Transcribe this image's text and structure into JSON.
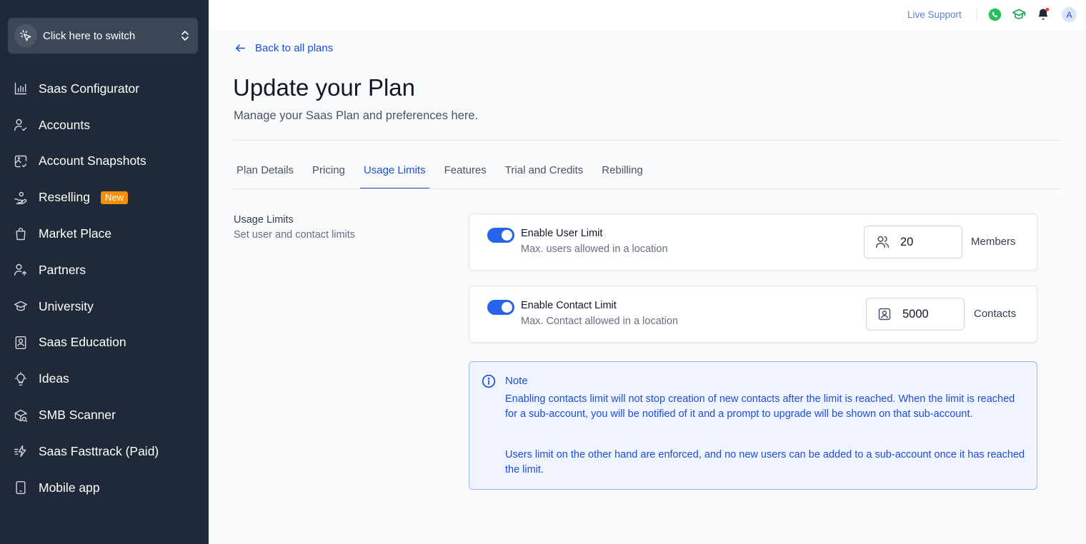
{
  "sidebar": {
    "switcher_label": "Click here to switch",
    "items": [
      {
        "label": "Saas Configurator",
        "icon": "bar-chart-icon"
      },
      {
        "label": "Accounts",
        "icon": "users-check-icon"
      },
      {
        "label": "Account Snapshots",
        "icon": "snapshot-icon"
      },
      {
        "label": "Reselling",
        "icon": "hand-coins-icon",
        "badge": "New"
      },
      {
        "label": "Market Place",
        "icon": "shopping-bag-icon"
      },
      {
        "label": "Partners",
        "icon": "users-arrow-icon"
      },
      {
        "label": "University",
        "icon": "graduation-cap-icon"
      },
      {
        "label": "Saas Education",
        "icon": "book-user-icon"
      },
      {
        "label": "Ideas",
        "icon": "lightbulb-icon"
      },
      {
        "label": "SMB Scanner",
        "icon": "package-search-icon"
      },
      {
        "label": "Saas Fasttrack (Paid)",
        "icon": "zap-fast-icon"
      },
      {
        "label": "Mobile app",
        "icon": "phone-icon"
      }
    ],
    "badge_color": "#f79009"
  },
  "topbar": {
    "live_support": "Live Support",
    "avatar_initial": "A"
  },
  "page": {
    "back_link": "Back to all plans",
    "title": "Update your Plan",
    "subtitle": "Manage your Saas Plan and preferences here."
  },
  "tabs": [
    {
      "label": "Plan Details",
      "active": false
    },
    {
      "label": "Pricing",
      "active": false
    },
    {
      "label": "Usage Limits",
      "active": true
    },
    {
      "label": "Features",
      "active": false
    },
    {
      "label": "Trial and Credits",
      "active": false
    },
    {
      "label": "Rebilling",
      "active": false
    }
  ],
  "usage": {
    "section_title": "Usage Limits",
    "section_desc": "Set user and contact limits",
    "user_limit": {
      "title": "Enable User Limit",
      "desc": "Max. users allowed in a location",
      "enabled": true,
      "value": "20",
      "unit": "Members"
    },
    "contact_limit": {
      "title": "Enable Contact Limit",
      "desc": "Max. Contact allowed in a location",
      "enabled": true,
      "value": "5000",
      "unit": "Contacts"
    }
  },
  "note": {
    "title": "Note",
    "p1": "Enabling contacts limit will not stop creation of new contacts after the limit is reached. When the limit is reached for a sub-account, you will be notified of it and a prompt to upgrade will be shown on that sub-account.",
    "p2": "Users limit on the other hand are enforced, and no new users can be added to a sub-account once it has reached the limit."
  },
  "colors": {
    "sidebar_bg": "#1f2937",
    "accent": "#1d4ed8",
    "toggle_on": "#2563eb"
  }
}
